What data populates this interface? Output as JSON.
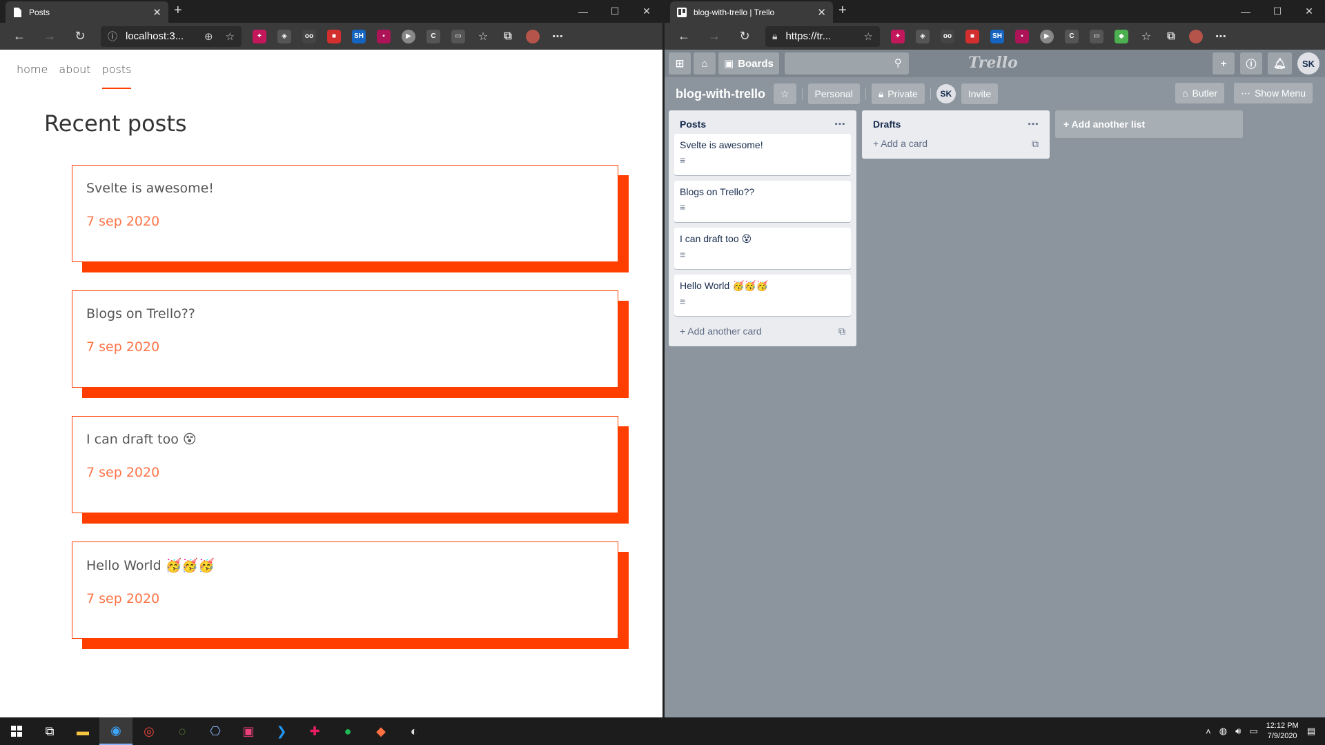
{
  "left_browser": {
    "tab_title": "Posts",
    "address": "localhost:3...",
    "site": {
      "nav": [
        "home",
        "about",
        "posts"
      ],
      "active_nav": "posts",
      "heading": "Recent posts",
      "posts": [
        {
          "title": "Svelte is awesome!",
          "date": "7 sep 2020"
        },
        {
          "title": "Blogs on Trello??",
          "date": "7 sep 2020"
        },
        {
          "title": "I can draft too 😵",
          "date": "7 sep 2020"
        },
        {
          "title": "Hello World 🥳🥳🥳",
          "date": "7 sep 2020"
        }
      ]
    }
  },
  "right_browser": {
    "tab_title": "blog-with-trello | Trello",
    "address": "https://tr...",
    "trello": {
      "boards_label": "Boards",
      "logo": "Trello",
      "user_initials": "SK",
      "board_name": "blog-with-trello",
      "team_label": "Personal",
      "visibility_label": "Private",
      "invite_label": "Invite",
      "butler_label": "Butler",
      "show_menu_label": "Show Menu",
      "add_list_label": "+ Add another list",
      "lists": [
        {
          "name": "Posts",
          "cards": [
            "Svelte is awesome!",
            "Blogs on Trello??",
            "I can draft too 😵",
            "Hello World 🥳🥳🥳"
          ],
          "add_label": "+ Add another card"
        },
        {
          "name": "Drafts",
          "cards": [],
          "add_label": "+ Add a card"
        }
      ]
    }
  },
  "taskbar": {
    "time": "12:12 PM",
    "date": "7/9/2020"
  }
}
